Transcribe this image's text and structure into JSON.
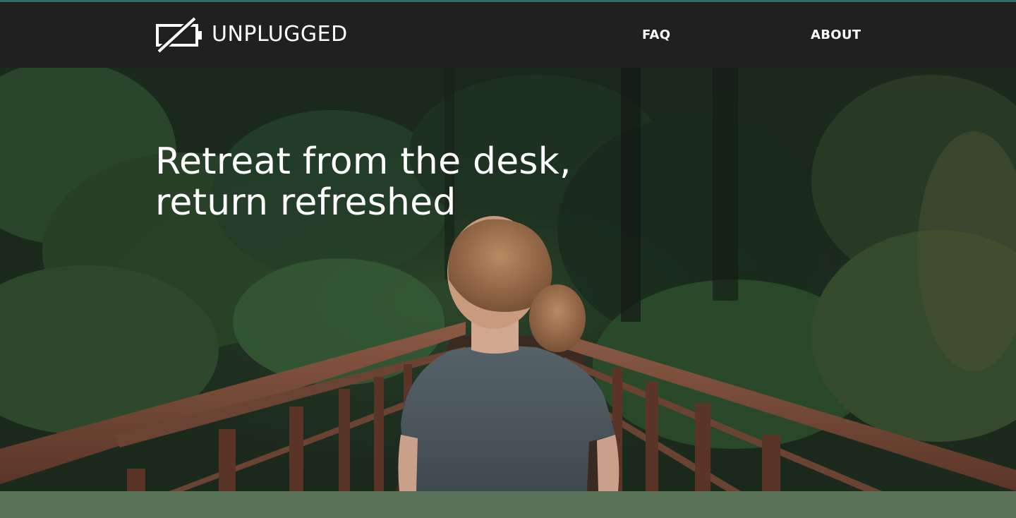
{
  "brand": {
    "name": "UNPLUGGED",
    "icon": "battery-slash-icon"
  },
  "nav": {
    "items": [
      {
        "label": "FAQ"
      },
      {
        "label": "ABOUT"
      }
    ]
  },
  "hero": {
    "headline_line1": "Retreat from the desk,",
    "headline_line2": "return refreshed",
    "image": "woman-on-forest-bridge-photo"
  },
  "colors": {
    "header_bg": "#202020",
    "accent_line": "#2f6a6a",
    "footer_band": "#5a7358",
    "text": "#ffffff"
  }
}
